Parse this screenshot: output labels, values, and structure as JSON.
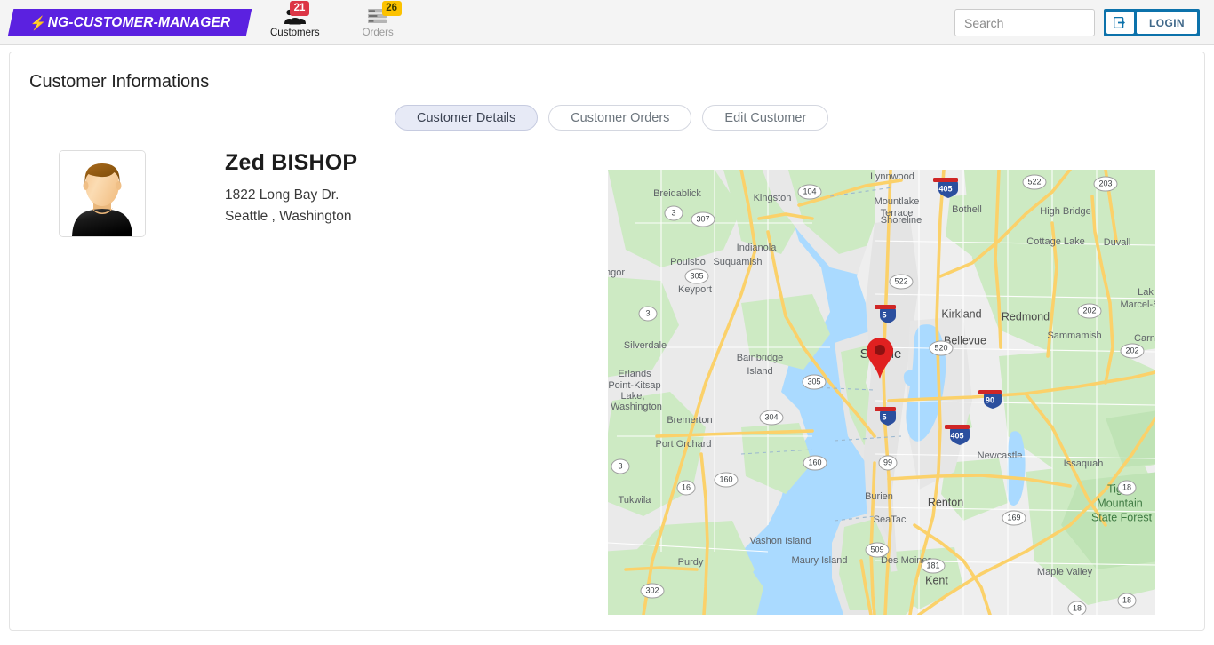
{
  "header": {
    "logo": {
      "icon": "lightning-bolt-icon",
      "text": "NG-CUSTOMER-MANAGER",
      "background": "#5b21e0"
    },
    "nav_items": [
      {
        "label": "Customers",
        "icon": "people-group-icon",
        "badge": "21",
        "badge_color": "#dc3545",
        "active": true
      },
      {
        "label": "Orders",
        "icon": "list-rows-icon",
        "badge": "26",
        "badge_color": "#fcc200",
        "active": false
      }
    ],
    "search": {
      "value": "",
      "placeholder": "Search"
    },
    "login": {
      "label": "LOGIN",
      "icon": "sign-in-icon",
      "background": "#0c72ab"
    }
  },
  "main": {
    "page_title": "Customer Informations",
    "tabs": [
      {
        "label": "Customer Details",
        "active": true
      },
      {
        "label": "Customer Orders",
        "active": false
      },
      {
        "label": "Edit Customer",
        "active": false
      }
    ],
    "customer": {
      "avatar": "male-avatar-placeholder",
      "name": "Zed BISHOP",
      "address_line1": "1822 Long Bay Dr.",
      "address_line2": "Seattle , Washington"
    },
    "map": {
      "marker_label": "Seattle",
      "marker_color": "#e02020",
      "labels": {
        "breidablick": "Breidablick",
        "kingston": "Kingston",
        "lynnwood": "Lynnwood",
        "mountlake_terrace": "Mountlake",
        "mountlake_terrace2": "Terrace",
        "high_bridge": "High Bridge",
        "indianola": "Indianola",
        "suquamish": "Suquamish",
        "poulsbo": "Poulsbo",
        "shoreline": "Shoreline",
        "bothell": "Bothell",
        "cottage_lake": "Cottage Lake",
        "duvall": "Duvall",
        "bangor": "ngor",
        "keyport": "Keyport",
        "kirkland": "Kirkland",
        "redmond": "Redmond",
        "lake_marcel": "Lak",
        "lake_marcel2": "Marcel-St",
        "silverdale": "Silverdale",
        "bainbridge": "Bainbridge",
        "bainbridge2": "Island",
        "bellevue": "Bellevue",
        "sammamish": "Sammamish",
        "carnation": "Carna",
        "erlands": "Erlands",
        "erlands2": "Point-Kitsap",
        "lake_washington": "Lake,",
        "lake_washington2": "Washington",
        "seattle": "Seattle",
        "bremerton": "Bremerton",
        "newcastle": "Newcastle",
        "issaquah": "Issaquah",
        "tiger1": "Tiger",
        "tiger2": "Mountain",
        "tiger3": "State Forest",
        "port_orchard": "Port Orchard",
        "tukwila": "Tukwila",
        "renton": "Renton",
        "burien": "Burien",
        "seatac": "SeaTac",
        "vashon": "Vashon Island",
        "des_moines": "Des Moines",
        "purdy": "Purdy",
        "maury": "Maury Island",
        "kent": "Kent",
        "maple_valley": "Maple Valley"
      },
      "route_shields": [
        "104",
        "3",
        "307",
        "305",
        "3",
        "305",
        "304",
        "160",
        "16",
        "3",
        "302",
        "522",
        "522",
        "203",
        "520",
        "202",
        "202",
        "99",
        "169",
        "181",
        "509",
        "18",
        "18",
        "160"
      ],
      "interstate_shields": [
        "405",
        "5",
        "5",
        "90",
        "405"
      ]
    }
  }
}
